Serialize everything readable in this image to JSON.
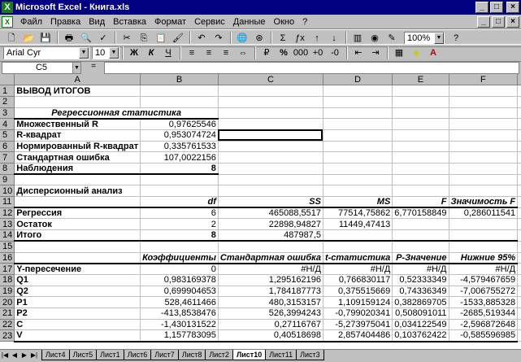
{
  "window": {
    "title": "Microsoft Excel - Книга.xls",
    "app_icon": "excel-icon",
    "min": "_",
    "max": "□",
    "close": "×"
  },
  "menu": [
    {
      "label": "Файл"
    },
    {
      "label": "Правка"
    },
    {
      "label": "Вид"
    },
    {
      "label": "Вставка"
    },
    {
      "label": "Формат"
    },
    {
      "label": "Сервис"
    },
    {
      "label": "Данные"
    },
    {
      "label": "Окно"
    },
    {
      "label": "?"
    }
  ],
  "toolbar1": {
    "zoom": "100%"
  },
  "toolbar2": {
    "font": "Arial Cyr",
    "size": "10",
    "bold": "Ж",
    "italic": "К",
    "underline": "Ч",
    "percent": "%"
  },
  "formula": {
    "cell": "C5",
    "value": ""
  },
  "columns": [
    "A",
    "B",
    "C",
    "D",
    "E",
    "F"
  ],
  "rows": [
    {
      "n": "1",
      "c": [
        "ВЫВОД ИТОГОВ",
        "",
        "",
        "",
        "",
        ""
      ]
    },
    {
      "n": "2",
      "c": [
        "",
        "",
        "",
        "",
        "",
        ""
      ]
    },
    {
      "n": "3",
      "c": [
        "Регрессионная статистика",
        "",
        "",
        "",
        "",
        ""
      ]
    },
    {
      "n": "4",
      "c": [
        "Множественный R",
        "0,97625546",
        "",
        "",
        "",
        ""
      ]
    },
    {
      "n": "5",
      "c": [
        "R-квадрат",
        "0,953074724",
        "",
        "",
        "",
        ""
      ]
    },
    {
      "n": "6",
      "c": [
        "Нормированный R-квадрат",
        "0,335761533",
        "",
        "",
        "",
        ""
      ]
    },
    {
      "n": "7",
      "c": [
        "Стандартная ошибка",
        "107,0022156",
        "",
        "",
        "",
        ""
      ]
    },
    {
      "n": "8",
      "c": [
        "Наблюдения",
        "8",
        "",
        "",
        "",
        ""
      ]
    },
    {
      "n": "9",
      "c": [
        "",
        "",
        "",
        "",
        "",
        ""
      ]
    },
    {
      "n": "10",
      "c": [
        "Дисперсионный анализ",
        "",
        "",
        "",
        "",
        ""
      ]
    },
    {
      "n": "11",
      "c": [
        "",
        "df",
        "SS",
        "MS",
        "F",
        "Значимость F"
      ]
    },
    {
      "n": "12",
      "c": [
        "Регрессия",
        "6",
        "465088,5517",
        "77514,75862",
        "6,770158849",
        "0,286011541"
      ]
    },
    {
      "n": "13",
      "c": [
        "Остаток",
        "2",
        "22898,94827",
        "11449,47413",
        "",
        ""
      ]
    },
    {
      "n": "14",
      "c": [
        "Итого",
        "8",
        "487987,5",
        "",
        "",
        ""
      ]
    },
    {
      "n": "15",
      "c": [
        "",
        "",
        "",
        "",
        "",
        ""
      ]
    },
    {
      "n": "16",
      "c": [
        "",
        "Коэффициенты",
        "Стандартная ошибка",
        "t-статистика",
        "P-Значение",
        "Нижние 95%"
      ]
    },
    {
      "n": "17",
      "c": [
        "Y-пересечение",
        "0",
        "#Н/Д",
        "#Н/Д",
        "#Н/Д",
        "#Н/Д"
      ]
    },
    {
      "n": "18",
      "c": [
        "Q1",
        "0,983169378",
        "1,295162196",
        "0,766830117",
        "0,52333349",
        "-4,579467659"
      ]
    },
    {
      "n": "19",
      "c": [
        "Q2",
        "0,699904653",
        "1,784187773",
        "0,375515669",
        "0,74336349",
        "-7,006755272"
      ]
    },
    {
      "n": "20",
      "c": [
        "P1",
        "528,4611466",
        "480,3153157",
        "1,109159124",
        "0,382869705",
        "-1533,885328"
      ]
    },
    {
      "n": "21",
      "c": [
        "P2",
        "-413,8538476",
        "526,3994243",
        "-0,799020341",
        "0,508091011",
        "-2685,519344"
      ]
    },
    {
      "n": "22",
      "c": [
        "C",
        "-1,430131522",
        "0,27116767",
        "-5,273975041",
        "0,034122549",
        "-2,596872648"
      ]
    },
    {
      "n": "23",
      "c": [
        "V",
        "1,157783095",
        "0,40518698",
        "2,857404486",
        "0,103762422",
        "-0,585596985"
      ]
    }
  ],
  "sheets": [
    "Лист4",
    "Лист5",
    "Лист1",
    "Лист6",
    "Лист7",
    "Лист8",
    "Лист2",
    "Лист10",
    "Лист11",
    "Лист3"
  ],
  "active_sheet": "Лист10"
}
